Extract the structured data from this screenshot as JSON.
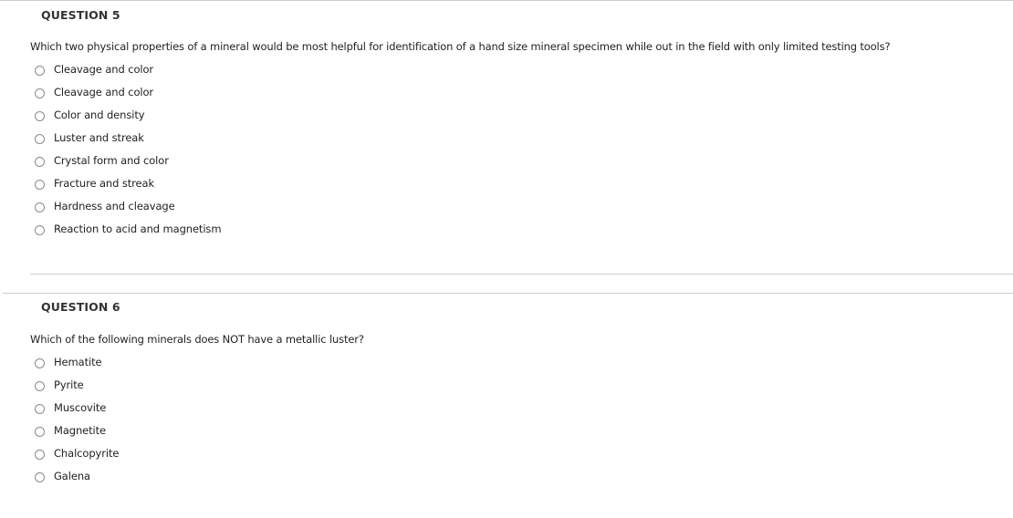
{
  "questions": [
    {
      "header": "QUESTION 5",
      "text": "Which two physical properties of a mineral would be most helpful for identification of a hand size mineral specimen while out in the field with only limited testing tools?",
      "answers": [
        {
          "label": "Cleavage and color",
          "selected": false
        },
        {
          "label": "Cleavage and color",
          "selected": false
        },
        {
          "label": "Color and density",
          "selected": false
        },
        {
          "label": "Luster and streak",
          "selected": false
        },
        {
          "label": "Crystal form and color",
          "selected": false
        },
        {
          "label": "Fracture and streak",
          "selected": false
        },
        {
          "label": "Hardness and cleavage",
          "selected": false
        },
        {
          "label": "Reaction to acid and magnetism",
          "selected": false
        }
      ]
    },
    {
      "header": "QUESTION 6",
      "text": "Which of the following minerals does NOT have a metallic luster?",
      "answers": [
        {
          "label": "Hematite",
          "selected": false
        },
        {
          "label": "Pyrite",
          "selected": false
        },
        {
          "label": "Muscovite",
          "selected": false
        },
        {
          "label": "Magnetite",
          "selected": false
        },
        {
          "label": "Chalcopyrite",
          "selected": false
        },
        {
          "label": "Galena",
          "selected": false
        }
      ]
    }
  ],
  "colors": {
    "separator": "#cccccc",
    "radio_border": "#8a8a8a",
    "text": "#222222",
    "header": "#333333"
  }
}
